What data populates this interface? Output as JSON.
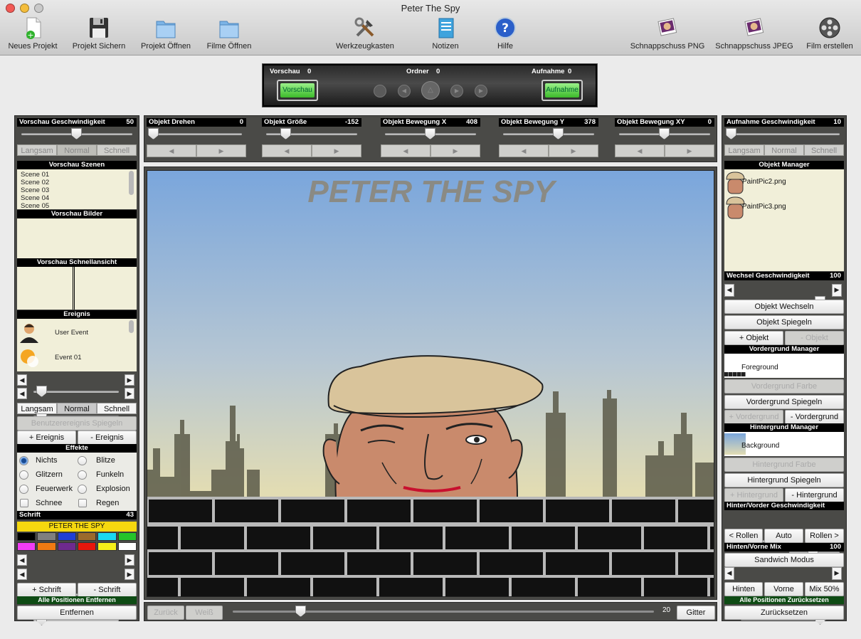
{
  "window": {
    "title": "Peter The Spy"
  },
  "toolbar": [
    {
      "label": "Neues Projekt",
      "icon": "new-project-icon"
    },
    {
      "label": "Projekt Sichern",
      "icon": "floppy-disk-icon"
    },
    {
      "label": "Projekt Öffnen",
      "icon": "folder-icon"
    },
    {
      "label": "Filme Öffnen",
      "icon": "folder-icon"
    },
    {
      "label": "Werkzeugkasten",
      "icon": "tools-icon"
    },
    {
      "label": "Notizen",
      "icon": "notepad-icon"
    },
    {
      "label": "Hilfe",
      "icon": "help-icon"
    },
    {
      "label": "Schnappschuss PNG",
      "icon": "photo-icon"
    },
    {
      "label": "Schnappschuss JPEG",
      "icon": "photo-icon"
    },
    {
      "label": "Film erstellen",
      "icon": "film-reel-icon"
    }
  ],
  "transport": {
    "preview_label": "Vorschau",
    "preview_value": "0",
    "folder_label": "Ordner",
    "folder_value": "0",
    "record_label": "Aufnahme",
    "record_value": "0",
    "preview_button": "Vorschau",
    "record_button": "Aufnahme"
  },
  "left": {
    "speed_label": "Vorschau Geschwindigkeit",
    "speed_value": "50",
    "speed_seg": [
      "Langsam",
      "Normal",
      "Schnell"
    ],
    "scenes_header": "Vorschau Szenen",
    "scenes": [
      "Scene 01",
      "Scene 02",
      "Scene 03",
      "Scene 04",
      "Scene 05"
    ],
    "images_header": "Vorschau Bilder",
    "quick_header": "Vorschau Schnellansicht",
    "event_header": "Ereignis",
    "events": [
      "User Event",
      "Event 01"
    ],
    "seg2": [
      "Langsam",
      "Normal",
      "Schnell"
    ],
    "mirror_event": "Benutzerereignis Spiegeln",
    "add_event": "+ Ereignis",
    "remove_event": "- Ereignis",
    "effects_header": "Effekte",
    "effects": [
      "Nichts",
      "Blitze",
      "Glitzern",
      "Funkeln",
      "Feuerwerk",
      "Explosion",
      "Schnee",
      "Regen"
    ],
    "font_label": "Schrift",
    "font_value": "43",
    "font_text": "PETER THE SPY",
    "swatches": [
      "#000000",
      "#7f7f7f",
      "#1f3fd6",
      "#9b6a2c",
      "#19d9f0",
      "#25c42a",
      "#f23cf5",
      "#f07a12",
      "#6e2a8e",
      "#e8160c",
      "#f5f019",
      "#ffffff"
    ],
    "add_font": "+ Schrift",
    "remove_font": "- Schrift",
    "reset_all": "Alle Positionen Entfernen",
    "remove": "Entfernen"
  },
  "objects": [
    {
      "label": "Objekt Drehen",
      "value": "0"
    },
    {
      "label": "Objekt Größe",
      "value": "-152"
    },
    {
      "label": "Objekt Bewegung X",
      "value": "408"
    },
    {
      "label": "Objekt Bewegung Y",
      "value": "378"
    },
    {
      "label": "Objekt Bewegung XY",
      "value": "0"
    }
  ],
  "stage": {
    "title_text": "PETER THE SPY",
    "back_button": "Zurück",
    "white_button": "Weiß",
    "grid_value": "20",
    "grid_button": "Gitter"
  },
  "right": {
    "rec_speed_label": "Aufnahme Geschwindigkeit",
    "rec_speed_value": "10",
    "seg": [
      "Langsam",
      "Normal",
      "Schnell"
    ],
    "obj_manager": "Objekt Manager",
    "objects": [
      "PaintPic2.png",
      "PaintPic3.png"
    ],
    "swap_speed_label": "Wechsel Geschwindigkeit",
    "swap_speed_value": "100",
    "swap_object": "Objekt Wechseln",
    "mirror_object": "Objekt Spiegeln",
    "add_object": "+ Objekt",
    "remove_object": "- Objekt",
    "fg_manager": "Vordergrund Manager",
    "fg_item": "Foreground",
    "fg_color": "Vordergrund Farbe",
    "fg_mirror": "Vordergrund Spiegeln",
    "add_fg": "+ Vordergrund",
    "remove_fg": "- Vordergrund",
    "bg_manager": "Hintergrund Manager",
    "bg_item": "Background",
    "bg_color": "Hintergrund Farbe",
    "bg_mirror": "Hintergrund Spiegeln",
    "add_bg": "+ Hintergrund",
    "remove_bg": "- Hintergrund",
    "hv_speed_label": "Hinter/Vorder Geschwindigkeit",
    "roll_left": "< Rollen",
    "auto": "Auto",
    "roll_right": "Rollen >",
    "mix_label": "Hinten/Vorne Mix",
    "mix_value": "100",
    "sandwich": "Sandwich Modus",
    "back": "Hinten",
    "front": "Vorne",
    "mix50": "Mix 50%",
    "reset_label": "Alle Positionen Zurücksetzen",
    "reset_button": "Zurücksetzen"
  }
}
